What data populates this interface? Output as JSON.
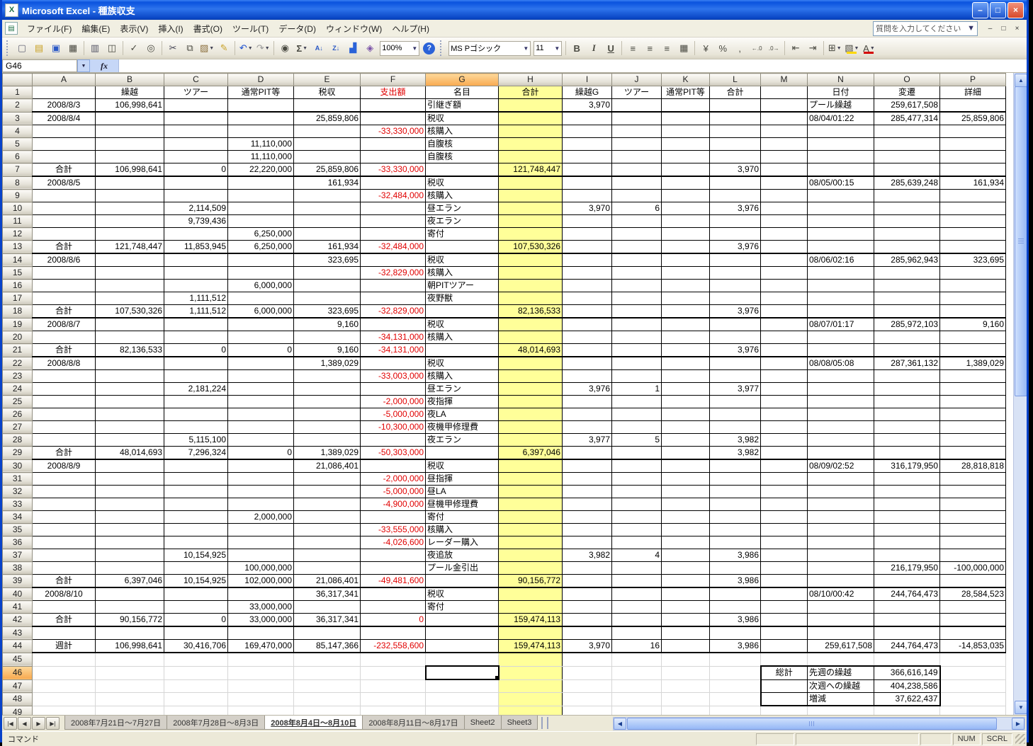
{
  "window": {
    "title": "Microsoft Excel - 種族収支",
    "controls": {
      "minimize": "–",
      "maximize": "□",
      "close": "×"
    }
  },
  "menu": {
    "items": [
      {
        "id": "file",
        "label": "ファイル(F)"
      },
      {
        "id": "edit",
        "label": "編集(E)"
      },
      {
        "id": "view",
        "label": "表示(V)"
      },
      {
        "id": "insert",
        "label": "挿入(I)"
      },
      {
        "id": "format",
        "label": "書式(O)"
      },
      {
        "id": "tools",
        "label": "ツール(T)"
      },
      {
        "id": "data",
        "label": "データ(D)"
      },
      {
        "id": "window",
        "label": "ウィンドウ(W)"
      },
      {
        "id": "help",
        "label": "ヘルプ(H)"
      }
    ],
    "question_placeholder": "質問を入力してください",
    "window_controls": [
      "–",
      "□",
      "×"
    ]
  },
  "toolbar": {
    "standard": [
      {
        "name": "new",
        "g": "▢"
      },
      {
        "name": "open",
        "g": "▤"
      },
      {
        "name": "save",
        "g": "▣"
      },
      {
        "name": "permission",
        "g": "▦"
      },
      {
        "type": "sep"
      },
      {
        "name": "print",
        "g": "▥"
      },
      {
        "name": "print-preview",
        "g": "◫"
      },
      {
        "type": "sep"
      },
      {
        "name": "spelling",
        "g": "✓"
      },
      {
        "name": "research",
        "g": "◎"
      },
      {
        "type": "sep"
      },
      {
        "name": "cut",
        "g": "✂"
      },
      {
        "name": "copy",
        "g": "⧉"
      },
      {
        "name": "paste",
        "g": "▨",
        "dd": true
      },
      {
        "name": "format-painter",
        "g": "✎"
      },
      {
        "type": "sep"
      },
      {
        "name": "undo",
        "g": "↶",
        "dd": true
      },
      {
        "name": "redo",
        "g": "↷",
        "dd": true
      },
      {
        "type": "sep"
      },
      {
        "name": "hyperlink",
        "g": "◉"
      },
      {
        "name": "autosum",
        "g": "Σ",
        "dd": true
      },
      {
        "name": "sort-ascending",
        "g": "A↓"
      },
      {
        "name": "sort-descending",
        "g": "Z↓"
      },
      {
        "name": "chart-wizard",
        "g": "▟"
      },
      {
        "name": "drawing",
        "g": "◈"
      },
      {
        "name": "zoom",
        "type": "combo",
        "label": "100%"
      },
      {
        "name": "help",
        "g": "?"
      }
    ],
    "formatting": [
      {
        "name": "font-name",
        "type": "combo",
        "label": "MS Pゴシック",
        "w": 110
      },
      {
        "name": "font-size",
        "type": "combo",
        "label": "11",
        "w": 34
      },
      {
        "type": "sep"
      },
      {
        "name": "bold",
        "g": "B"
      },
      {
        "name": "italic",
        "g": "I"
      },
      {
        "name": "underline",
        "g": "U"
      },
      {
        "type": "sep"
      },
      {
        "name": "align-left",
        "g": "≡"
      },
      {
        "name": "align-center",
        "g": "≡"
      },
      {
        "name": "align-right",
        "g": "≡"
      },
      {
        "name": "merge-center",
        "g": "▦"
      },
      {
        "type": "sep"
      },
      {
        "name": "currency-style",
        "g": "¥"
      },
      {
        "name": "percent-style",
        "g": "%"
      },
      {
        "name": "comma-style",
        "g": ","
      },
      {
        "name": "increase-decimal",
        "g": "←.0"
      },
      {
        "name": "decrease-decimal",
        "g": ".0→"
      },
      {
        "type": "sep"
      },
      {
        "name": "decrease-indent",
        "g": "⇤"
      },
      {
        "name": "increase-indent",
        "g": "⇥"
      },
      {
        "type": "sep"
      },
      {
        "name": "borders",
        "g": "⊞",
        "dd": true
      },
      {
        "name": "fill-color",
        "g": "▧",
        "dd": true,
        "bar": true
      },
      {
        "name": "font-color",
        "g": "A",
        "dd": true,
        "bar": true
      }
    ]
  },
  "formula_bar": {
    "name_box": "G46",
    "fx": "fx",
    "formula": ""
  },
  "grid": {
    "active_cell": "G46",
    "active_col": "G",
    "active_row": 46,
    "columns": [
      "A",
      "B",
      "C",
      "D",
      "E",
      "F",
      "G",
      "H",
      "I",
      "J",
      "K",
      "L",
      "M",
      "N",
      "O",
      "P"
    ],
    "rows": [
      {
        "n": 1,
        "cells": {
          "B": "繰越",
          "C": "ツアー",
          "D": "通常PIT等",
          "E": "税収",
          "F": "支出額",
          "G": "名目",
          "H": "合計",
          "I": "繰越G",
          "J": "ツアー",
          "K": "通常PIT等",
          "L": "合計",
          "N": "日付",
          "O": "変遷",
          "P": "詳細"
        }
      },
      {
        "n": 2,
        "thick": true,
        "cells": {
          "A": "2008/8/3",
          "B": "106,998,641",
          "G": "引継ぎ額",
          "I": "3,970",
          "N": "プール繰越",
          "O": "259,617,508"
        }
      },
      {
        "n": 3,
        "cells": {
          "A": "2008/8/4",
          "E": "25,859,806",
          "G": "税収",
          "N": "08/04/01:22",
          "O": "285,477,314",
          "P": "25,859,806"
        }
      },
      {
        "n": 4,
        "cells": {
          "F": "-33,330,000",
          "G": "核購入"
        }
      },
      {
        "n": 5,
        "cells": {
          "D": "11,110,000",
          "G": "自腹核"
        }
      },
      {
        "n": 6,
        "cells": {
          "D": "11,110,000",
          "G": "自腹核"
        }
      },
      {
        "n": 7,
        "thick": true,
        "cells": {
          "A": "合計",
          "B": "106,998,641",
          "C": "0",
          "D": "22,220,000",
          "E": "25,859,806",
          "F": "-33,330,000",
          "H": "121,748,447",
          "L": "3,970"
        }
      },
      {
        "n": 8,
        "cells": {
          "A": "2008/8/5",
          "E": "161,934",
          "G": "税収",
          "N": "08/05/00:15",
          "O": "285,639,248",
          "P": "161,934"
        }
      },
      {
        "n": 9,
        "cells": {
          "F": "-32,484,000",
          "G": "核購入"
        }
      },
      {
        "n": 10,
        "cells": {
          "C": "2,114,509",
          "G": "昼エラン",
          "I": "3,970",
          "J": "6",
          "L": "3,976"
        }
      },
      {
        "n": 11,
        "cells": {
          "C": "9,739,436",
          "G": "夜エラン"
        }
      },
      {
        "n": 12,
        "cells": {
          "D": "6,250,000",
          "G": "寄付"
        }
      },
      {
        "n": 13,
        "thick": true,
        "cells": {
          "A": "合計",
          "B": "121,748,447",
          "C": "11,853,945",
          "D": "6,250,000",
          "E": "161,934",
          "F": "-32,484,000",
          "H": "107,530,326",
          "L": "3,976"
        }
      },
      {
        "n": 14,
        "cells": {
          "A": "2008/8/6",
          "E": "323,695",
          "G": "税収",
          "N": "08/06/02:16",
          "O": "285,962,943",
          "P": "323,695"
        }
      },
      {
        "n": 15,
        "cells": {
          "F": "-32,829,000",
          "G": "核購入"
        }
      },
      {
        "n": 16,
        "cells": {
          "D": "6,000,000",
          "G": "朝PITツアー"
        }
      },
      {
        "n": 17,
        "cells": {
          "C": "1,111,512",
          "G": "夜野獣"
        }
      },
      {
        "n": 18,
        "thick": true,
        "cells": {
          "A": "合計",
          "B": "107,530,326",
          "C": "1,111,512",
          "D": "6,000,000",
          "E": "323,695",
          "F": "-32,829,000",
          "H": "82,136,533",
          "L": "3,976"
        }
      },
      {
        "n": 19,
        "cells": {
          "A": "2008/8/7",
          "E": "9,160",
          "G": "税収",
          "N": "08/07/01:17",
          "O": "285,972,103",
          "P": "9,160"
        }
      },
      {
        "n": 20,
        "cells": {
          "F": "-34,131,000",
          "G": "核購入"
        }
      },
      {
        "n": 21,
        "thick": true,
        "cells": {
          "A": "合計",
          "B": "82,136,533",
          "C": "0",
          "D": "0",
          "E": "9,160",
          "F": "-34,131,000",
          "H": "48,014,693",
          "L": "3,976"
        }
      },
      {
        "n": 22,
        "cells": {
          "A": "2008/8/8",
          "E": "1,389,029",
          "G": "税収",
          "N": "08/08/05:08",
          "O": "287,361,132",
          "P": "1,389,029"
        }
      },
      {
        "n": 23,
        "cells": {
          "F": "-33,003,000",
          "G": "核購入"
        }
      },
      {
        "n": 24,
        "cells": {
          "C": "2,181,224",
          "G": "昼エラン",
          "I": "3,976",
          "J": "1",
          "L": "3,977"
        }
      },
      {
        "n": 25,
        "cells": {
          "F": "-2,000,000",
          "G": "夜指揮"
        }
      },
      {
        "n": 26,
        "cells": {
          "F": "-5,000,000",
          "G": "夜LA"
        }
      },
      {
        "n": 27,
        "cells": {
          "F": "-10,300,000",
          "G": "夜機甲修理費"
        }
      },
      {
        "n": 28,
        "cells": {
          "C": "5,115,100",
          "G": "夜エラン",
          "I": "3,977",
          "J": "5",
          "L": "3,982"
        }
      },
      {
        "n": 29,
        "thick": true,
        "cells": {
          "A": "合計",
          "B": "48,014,693",
          "C": "7,296,324",
          "D": "0",
          "E": "1,389,029",
          "F": "-50,303,000",
          "H": "6,397,046",
          "L": "3,982"
        }
      },
      {
        "n": 30,
        "cells": {
          "A": "2008/8/9",
          "E": "21,086,401",
          "G": "税収",
          "N": "08/09/02:52",
          "O": "316,179,950",
          "P": "28,818,818"
        }
      },
      {
        "n": 31,
        "cells": {
          "F": "-2,000,000",
          "G": "昼指揮"
        }
      },
      {
        "n": 32,
        "cells": {
          "F": "-5,000,000",
          "G": "昼LA"
        }
      },
      {
        "n": 33,
        "cells": {
          "F": "-4,900,000",
          "G": "昼機甲修理費"
        }
      },
      {
        "n": 34,
        "cells": {
          "D": "2,000,000",
          "G": "寄付"
        }
      },
      {
        "n": 35,
        "cells": {
          "F": "-33,555,000",
          "G": "核購入"
        }
      },
      {
        "n": 36,
        "cells": {
          "F": "-4,026,600",
          "G": "レーダー購入"
        }
      },
      {
        "n": 37,
        "cells": {
          "C": "10,154,925",
          "G": "夜追放",
          "I": "3,982",
          "J": "4",
          "L": "3,986"
        }
      },
      {
        "n": 38,
        "cells": {
          "D": "100,000,000",
          "G": "プール金引出",
          "O": "216,179,950",
          "P": "-100,000,000"
        }
      },
      {
        "n": 39,
        "thick": true,
        "cells": {
          "A": "合計",
          "B": "6,397,046",
          "C": "10,154,925",
          "D": "102,000,000",
          "E": "21,086,401",
          "F": "-49,481,600",
          "H": "90,156,772",
          "L": "3,986"
        }
      },
      {
        "n": 40,
        "cells": {
          "A": "2008/8/10",
          "E": "36,317,341",
          "G": "税収",
          "N": "08/10/00:42",
          "O": "244,764,473",
          "P": "28,584,523"
        }
      },
      {
        "n": 41,
        "cells": {
          "D": "33,000,000",
          "G": "寄付"
        }
      },
      {
        "n": 42,
        "thick": true,
        "cells": {
          "A": "合計",
          "B": "90,156,772",
          "C": "0",
          "D": "33,000,000",
          "E": "36,317,341",
          "F": "0",
          "H": "159,474,113",
          "L": "3,986"
        }
      },
      {
        "n": 43,
        "cells": {}
      },
      {
        "n": 44,
        "thick": true,
        "cells": {
          "A": "週計",
          "B": "106,998,641",
          "C": "30,416,706",
          "D": "169,470,000",
          "E": "85,147,366",
          "F": "-232,558,600",
          "H": "159,474,113",
          "I": "3,970",
          "J": "16",
          "L": "3,986",
          "N": "259,617,508",
          "O": "244,764,473",
          "P": "-14,853,035"
        }
      },
      {
        "n": 45,
        "cells": {}
      },
      {
        "n": 46,
        "cells": {
          "M": "総計",
          "N": "先週の繰越",
          "O": "366,616,149"
        }
      },
      {
        "n": 47,
        "cells": {
          "N": "次週への繰越",
          "O": "404,238,586"
        }
      },
      {
        "n": 48,
        "cells": {
          "N": "増減",
          "O": "37,622,437"
        }
      },
      {
        "n": 49,
        "cells": {}
      }
    ]
  },
  "sheet_tabs": {
    "tabs": [
      {
        "label": "2008年7月21日～7月27日",
        "active": false
      },
      {
        "label": "2008年7月28日～8月3日",
        "active": false
      },
      {
        "label": "2008年8月4日～8月10日",
        "active": true
      },
      {
        "label": "2008年8月11日～8月17日",
        "active": false
      },
      {
        "label": "Sheet2",
        "active": false
      },
      {
        "label": "Sheet3",
        "active": false
      }
    ]
  },
  "status_bar": {
    "mode": "コマンド",
    "indicators": [
      "NUM",
      "SCRL"
    ]
  },
  "colors": {
    "accent_selection": "#F8A94F",
    "total_column": "#FFFF99",
    "expense_red": "#E10000"
  }
}
